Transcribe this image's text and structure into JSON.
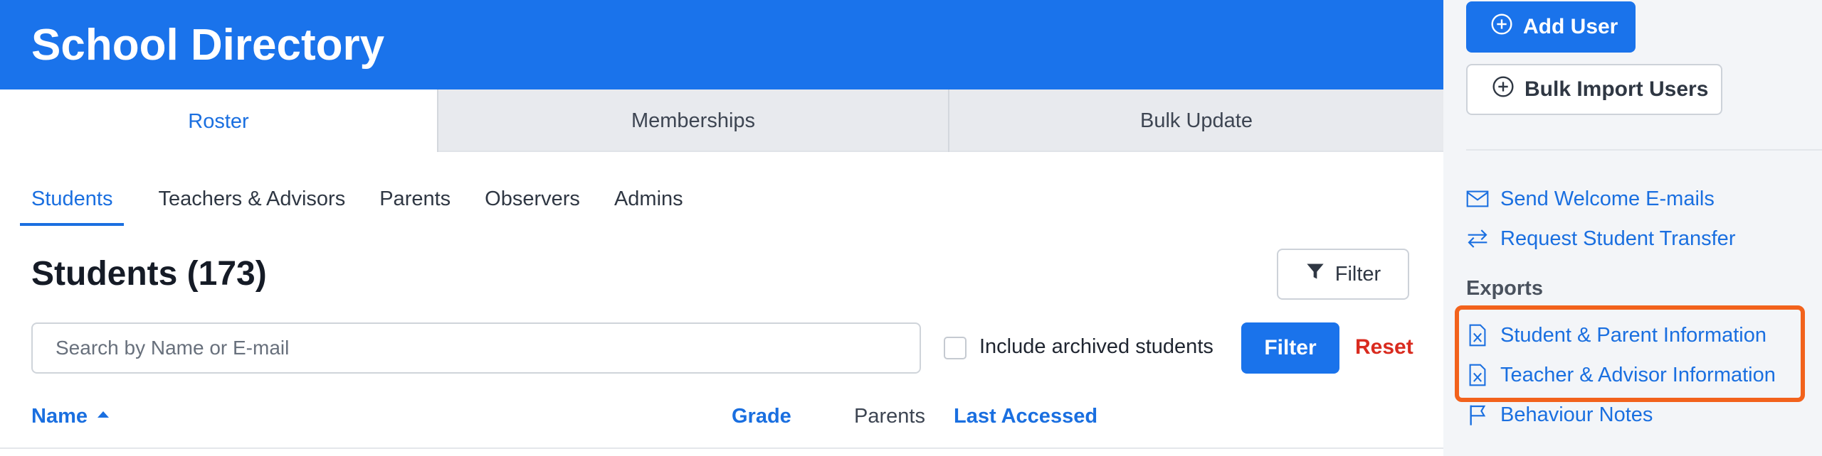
{
  "header": {
    "title": "School Directory"
  },
  "tabs": [
    {
      "label": "Roster",
      "active": true
    },
    {
      "label": "Memberships",
      "active": false
    },
    {
      "label": "Bulk Update",
      "active": false
    }
  ],
  "subtabs": [
    {
      "label": "Students",
      "active": true
    },
    {
      "label": "Teachers & Advisors",
      "active": false
    },
    {
      "label": "Parents",
      "active": false
    },
    {
      "label": "Observers",
      "active": false
    },
    {
      "label": "Admins",
      "active": false
    }
  ],
  "section": {
    "title": "Students (173)",
    "filter_button": "Filter"
  },
  "search": {
    "placeholder": "Search by Name or E-mail",
    "value": ""
  },
  "archived": {
    "label": "Include archived students",
    "checked": false
  },
  "actions": {
    "apply": "Filter",
    "reset": "Reset"
  },
  "columns": [
    {
      "label": "Name",
      "sortable": true,
      "sorted": "asc"
    },
    {
      "label": "Grade",
      "sortable": true
    },
    {
      "label": "Parents",
      "sortable": false
    },
    {
      "label": "Last Accessed",
      "sortable": true
    }
  ],
  "sidebar": {
    "add_user": "Add User",
    "bulk_import": "Bulk Import Users",
    "links": [
      {
        "label": "Send Welcome E-mails",
        "icon": "envelope-icon"
      },
      {
        "label": "Request Student Transfer",
        "icon": "transfer-arrows-icon"
      }
    ],
    "exports_heading": "Exports",
    "exports": [
      {
        "label": "Student & Parent Information",
        "icon": "excel-file-icon"
      },
      {
        "label": "Teacher & Advisor Information",
        "icon": "excel-file-icon"
      },
      {
        "label": "Behaviour Notes",
        "icon": "flag-icon"
      }
    ]
  },
  "colors": {
    "brand_blue": "#1a73eb",
    "link_blue": "#1a6fe0",
    "reset_red": "#d92b1f",
    "highlight_orange": "#f2621c"
  }
}
